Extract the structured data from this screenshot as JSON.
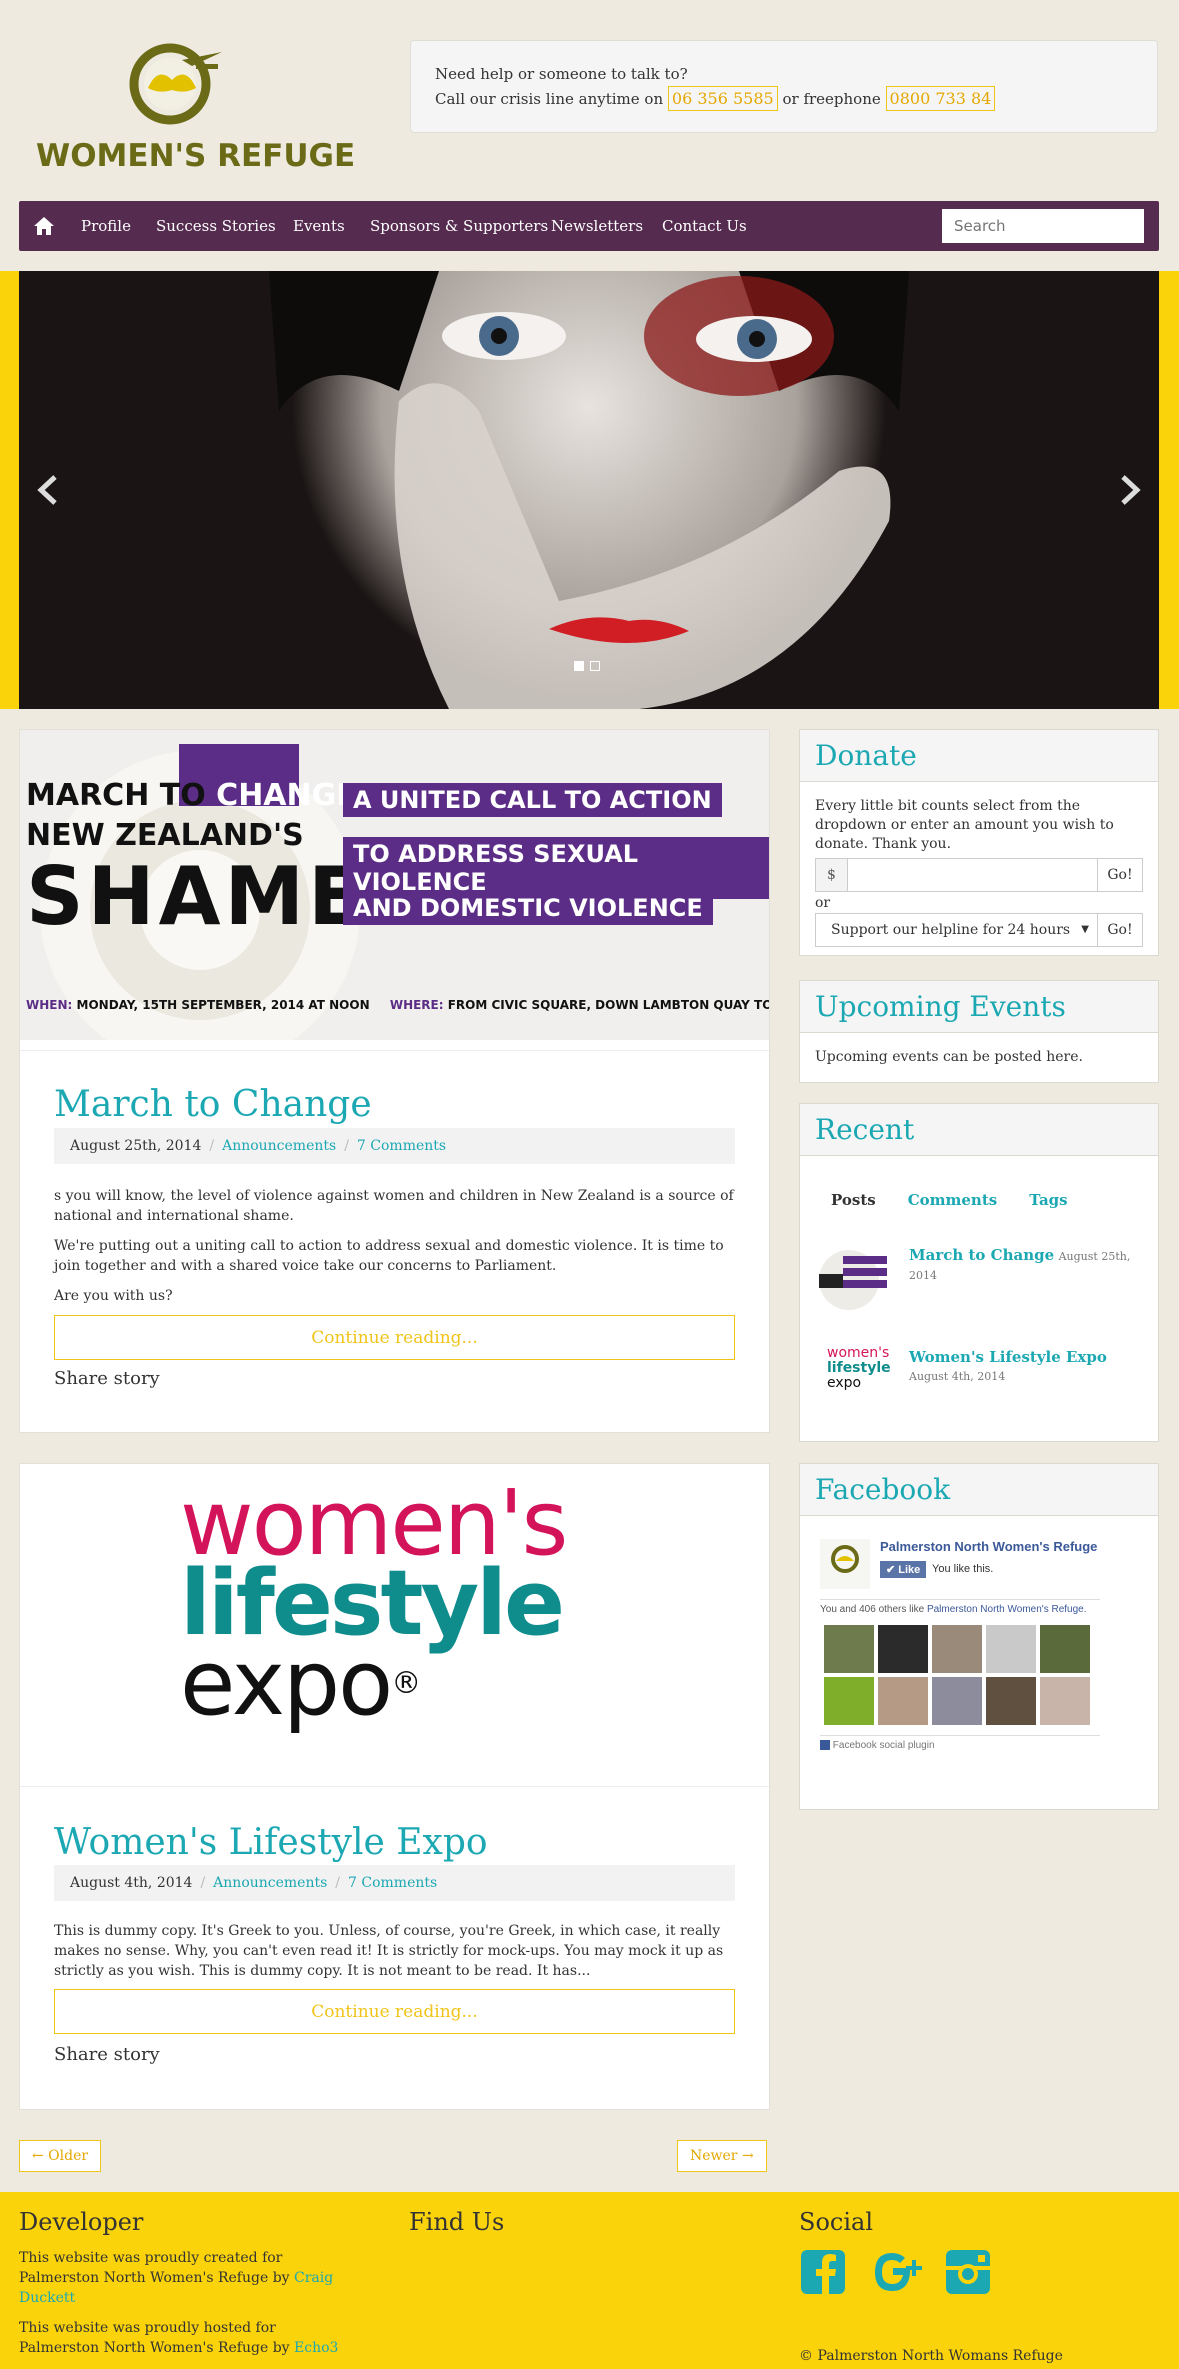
{
  "header": {
    "logo_text": "WOMEN'S REFUGE",
    "help_line1": "Need help or someone to talk to?",
    "help_line2_prefix": "Call our crisis line anytime on",
    "crisis_phone": "06 356 5585",
    "help_or": "or freephone",
    "freephone": "0800 733 84"
  },
  "nav": {
    "items": [
      "Profile",
      "Success Stories",
      "Events",
      "Sponsors & Supporters",
      "Newsletters",
      "Contact Us"
    ],
    "search_placeholder": "Search"
  },
  "colors": {
    "accent": "#1ba8b3",
    "nav_bg": "#552b4f",
    "brand_yellow": "#fad30a",
    "olive": "#6b6a16"
  },
  "posts": [
    {
      "banner": {
        "line1a": "MARCH TO",
        "line1b": "CHANGE",
        "line2": "NEW ZEALAND'S",
        "line3": "SHAME",
        "call1": "A UNITED CALL TO ACTION",
        "call2": "TO ADDRESS SEXUAL VIOLENCE",
        "call3": "AND DOMESTIC VIOLENCE",
        "when_label": "WHEN:",
        "when": "MONDAY, 15TH SEPTEMBER, 2014 AT NOON",
        "where_label": "WHERE:",
        "where": "FROM CIVIC SQUARE, DOWN LAMBTON QUAY TO PARLIAMENT STEPS"
      },
      "title": "March to Change",
      "date": "August 25th, 2014",
      "category": "Announcements",
      "comments": "7 Comments",
      "para1": "s you will know, the level of violence against women and children in New Zealand is a source of national and international shame.",
      "para2": "We're putting out a uniting call to action to address sexual and domestic violence. It is time to join together and with a shared voice take our concerns to Parliament.",
      "para3": "Are you with us?",
      "continue": "Continue reading...",
      "share": "Share story"
    },
    {
      "logo1": "women's",
      "logo2": "lifestyle",
      "logo3": "expo",
      "logo_mark": "®",
      "title": "Women's Lifestyle Expo",
      "date": "August 4th, 2014",
      "category": "Announcements",
      "comments": "7 Comments",
      "para1": "This is dummy copy. It's Greek to you. Unless, of course, you're Greek, in which case, it really makes no sense. Why, you can't even read it! It is strictly for mock-ups. You may mock it up as strictly as you wish. This is dummy copy. It is not meant to be read. It has...",
      "continue": "Continue reading...",
      "share": "Share story"
    }
  ],
  "pager": {
    "older": "← Older",
    "newer": "Newer →"
  },
  "sidebar": {
    "donate": {
      "title": "Donate",
      "text": "Every little bit counts select from the dropdown or enter an amount you wish to donate. Thank you.",
      "currency": "$",
      "go": "Go!",
      "or": "or",
      "select_value": "Support our helpline for 24 hours"
    },
    "events": {
      "title": "Upcoming Events",
      "text": "Upcoming events can be posted here."
    },
    "recent": {
      "title": "Recent",
      "tabs": [
        "Posts",
        "Comments",
        "Tags"
      ],
      "items": [
        {
          "title": "March to Change",
          "date": "August 25th, 2014"
        },
        {
          "title": "Women's Lifestyle Expo",
          "date": "August 4th, 2014"
        }
      ],
      "thumb2_text": "women's lifestyle expo"
    },
    "facebook": {
      "title": "Facebook",
      "page_name": "Palmerston North Women's Refuge",
      "like": "Like",
      "you_like": "You like this.",
      "others_prefix": "You and 406 others like",
      "others_page": "Palmerston North Women's Refuge.",
      "plugin": "Facebook social plugin"
    }
  },
  "footer": {
    "developer_title": "Developer",
    "dev_text1": "This website was proudly created for Palmerston North Women's Refuge by",
    "dev_link1": "Craig Duckett",
    "dev_text2": "This website was proudly hosted for Palmerston North Women's Refuge by",
    "dev_link2": "Echo3",
    "findus_title": "Find Us",
    "social_title": "Social",
    "copyright": "© Palmerston North Womans Refuge"
  }
}
